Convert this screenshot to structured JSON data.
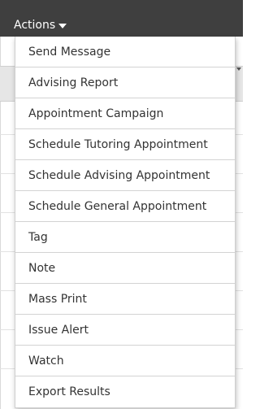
{
  "toolbar": {
    "actions_label": "Actions"
  },
  "actions_menu": {
    "items": [
      {
        "label": "Send Message"
      },
      {
        "label": "Advising Report"
      },
      {
        "label": "Appointment Campaign"
      },
      {
        "label": "Schedule Tutoring Appointment"
      },
      {
        "label": "Schedule Advising Appointment"
      },
      {
        "label": "Schedule General Appointment"
      },
      {
        "label": "Tag"
      },
      {
        "label": "Note"
      },
      {
        "label": "Mass Print"
      },
      {
        "label": "Issue Alert"
      },
      {
        "label": "Watch"
      },
      {
        "label": "Export Results"
      }
    ]
  },
  "colors": {
    "topbar": "#3f3f3f",
    "menu_text": "#333333",
    "divider": "#d3d3d3"
  }
}
